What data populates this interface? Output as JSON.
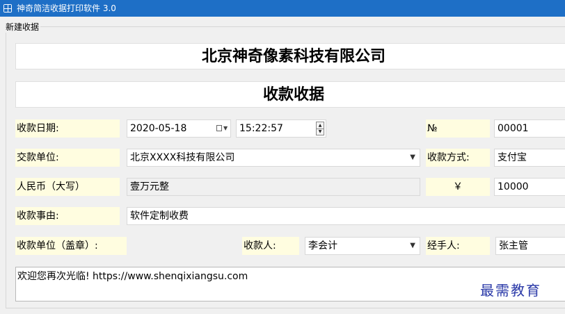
{
  "window": {
    "title": "神奇简洁收据打印软件 3.0"
  },
  "group": {
    "label": "新建收据"
  },
  "company": {
    "name": "北京神奇像素科技有限公司"
  },
  "receipt": {
    "heading": "收款收据"
  },
  "date": {
    "label": "收款日期:",
    "value": "2020-05-18",
    "time": "15:22:57"
  },
  "number": {
    "label": "№",
    "value": "00001"
  },
  "payer": {
    "label": "交款单位:",
    "value": "北京XXXX科技有限公司"
  },
  "payment_method": {
    "label": "收款方式:",
    "value": "支付宝"
  },
  "amount": {
    "label_upper": "人民币（大写）",
    "value_upper": "壹万元整",
    "currency_symbol": "￥",
    "value": "10000"
  },
  "reason": {
    "label": "收款事由:",
    "value": "软件定制收费"
  },
  "receiving_unit": {
    "label": "收款单位（盖章）:"
  },
  "receiver": {
    "label": "收款人:",
    "value": "李会计"
  },
  "handler": {
    "label": "经手人:",
    "value": "张主管"
  },
  "memo": {
    "value": "欢迎您再次光临! https://www.shenqixiangsu.com"
  },
  "watermark": {
    "text": "最需教育"
  }
}
